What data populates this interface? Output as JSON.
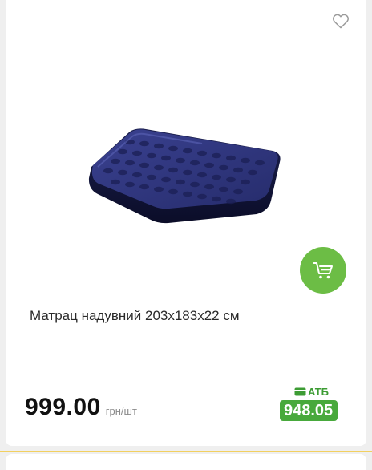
{
  "product": {
    "title": "Матрац надувний 203x183x22 см",
    "image_alt": "inflatable-mattress",
    "price": "999.00",
    "unit": "грн/шт",
    "card_label": "АТБ",
    "card_price": "948.05"
  },
  "icons": {
    "favorite": "heart-outline-icon",
    "cart": "shopping-cart-icon",
    "card": "card-icon"
  },
  "colors": {
    "cart_button": "#6cbd45",
    "atb_green": "#48a93c",
    "separator": "#f2d060"
  }
}
